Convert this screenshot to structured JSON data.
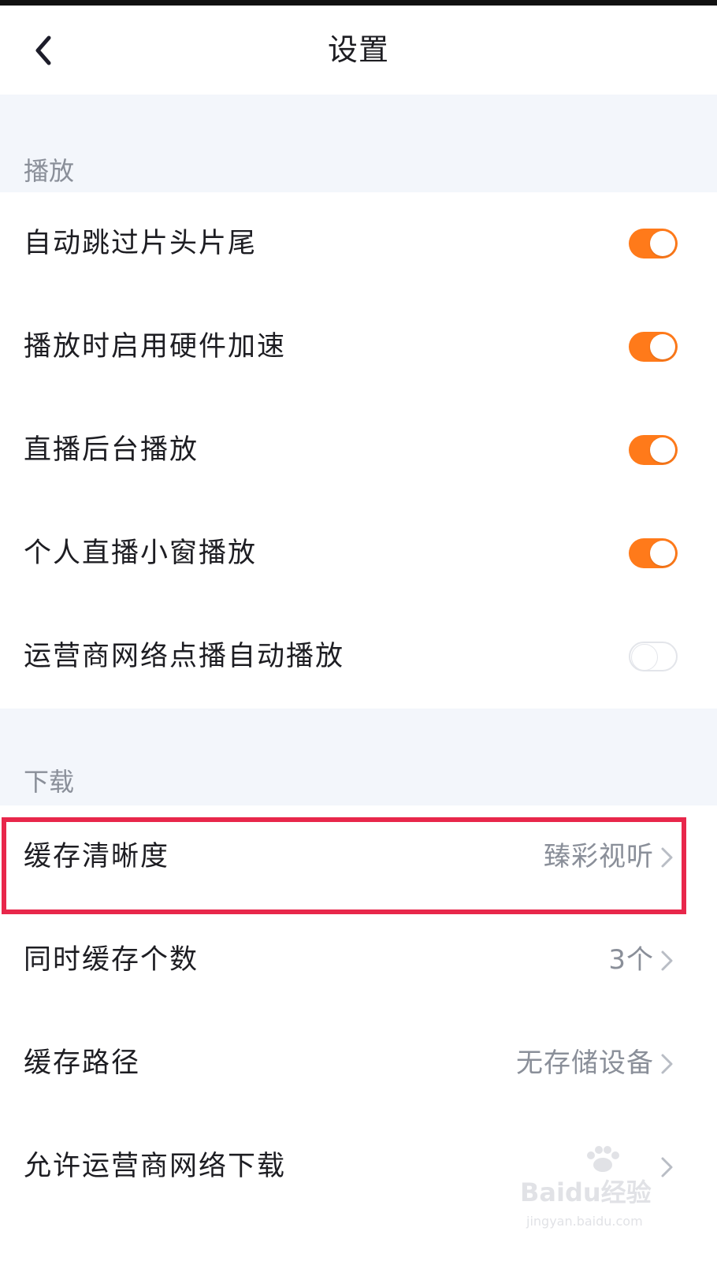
{
  "header": {
    "title": "设置"
  },
  "sections": {
    "playback": {
      "label": "播放",
      "items": [
        {
          "label": "自动跳过片头片尾",
          "toggle": "on"
        },
        {
          "label": "播放时启用硬件加速",
          "toggle": "on"
        },
        {
          "label": "直播后台播放",
          "toggle": "on"
        },
        {
          "label": "个人直播小窗播放",
          "toggle": "on"
        },
        {
          "label": "运营商网络点播自动播放",
          "toggle": "off"
        }
      ]
    },
    "download": {
      "label": "下载",
      "items": [
        {
          "label": "缓存清晰度",
          "value": "臻彩视听"
        },
        {
          "label": "同时缓存个数",
          "value": "3个"
        },
        {
          "label": "缓存路径",
          "value": "无存储设备"
        },
        {
          "label": "允许运营商网络下载",
          "value": ""
        }
      ]
    }
  },
  "colors": {
    "accent": "#ff7a1a",
    "highlight": "#e8274b",
    "page_background": "#f3f6fb"
  },
  "watermark": {
    "brand": "Baidu经验",
    "url": "jingyan.baidu.com"
  }
}
